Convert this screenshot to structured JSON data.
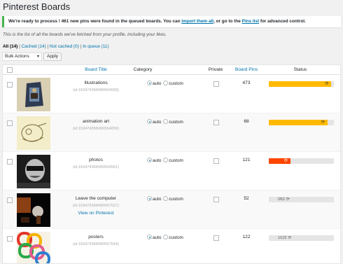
{
  "page_title": "Pinterest Boards",
  "notice": {
    "text_before": "We're ready to process ! 461 new pins were found in the queued boards. You can ",
    "import_all_link": "import them all",
    "text_middle": ", or go to the ",
    "pins_list_link": "Pins list",
    "text_after": " for advanced control."
  },
  "intro": "This is the list of all the boards we've fetched from your profile, including your likes.",
  "filters": {
    "all": "All (14)",
    "sep1": " | ",
    "cached": "Cached (14)",
    "sep2": " | ",
    "not_cached": "Not cached (0)",
    "sep3": " | ",
    "in_queue": "In queue (11)"
  },
  "bulk_actions": {
    "label": "Bulk Actions",
    "caret": "▾",
    "apply": "Apply"
  },
  "columns": {
    "board_title": "Board Title",
    "category": "Category",
    "private": "Private",
    "pins": "Board Pins",
    "status": "Status"
  },
  "category_options": {
    "auto": "auto",
    "custom": "custom"
  },
  "status_icon": "refresh-icon",
  "colors": {
    "yellow": "#ffba00",
    "red": "#ff4500",
    "track": "#e5e5e5",
    "link": "#0073aa",
    "notice_border": "#46b450"
  },
  "rows": [
    {
      "title": "Illustrations",
      "id": "(id:153474368490564658)",
      "view_link": "",
      "pins": "473",
      "progress": 0.96,
      "color": "#ffba00",
      "icon": "⟳",
      "label": ""
    },
    {
      "title": "animation art",
      "id": "(id:153474368490564659)",
      "view_link": "",
      "pins": "68",
      "progress": 0.9,
      "color": "#ffba00",
      "icon": "⟳",
      "label": ""
    },
    {
      "title": "photos",
      "id": "(id:153474368490564661)",
      "view_link": "",
      "pins": "121",
      "progress": 0.33,
      "color": "#ff4500",
      "icon": "⟳",
      "label": ""
    },
    {
      "title": "Leave the computer",
      "id": "(id:153474368490567637)",
      "view_link": "View on Pinterest",
      "pins": "52",
      "progress": 0,
      "color": "#ffba00",
      "icon": "⟳",
      "label": "0/52"
    },
    {
      "title": "posters",
      "id": "(id:153474368490567644)",
      "view_link": "",
      "pins": "122",
      "progress": 0,
      "color": "#ffba00",
      "icon": "⟳",
      "label": "1/122"
    }
  ]
}
